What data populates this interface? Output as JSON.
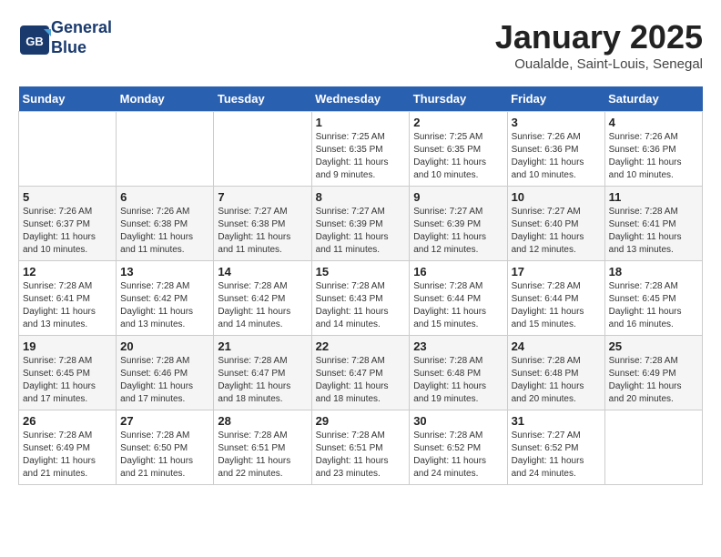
{
  "header": {
    "logo_line1": "General",
    "logo_line2": "Blue",
    "month": "January 2025",
    "location": "Oualalde, Saint-Louis, Senegal"
  },
  "days_of_week": [
    "Sunday",
    "Monday",
    "Tuesday",
    "Wednesday",
    "Thursday",
    "Friday",
    "Saturday"
  ],
  "weeks": [
    [
      {
        "day": "",
        "info": ""
      },
      {
        "day": "",
        "info": ""
      },
      {
        "day": "",
        "info": ""
      },
      {
        "day": "1",
        "info": "Sunrise: 7:25 AM\nSunset: 6:35 PM\nDaylight: 11 hours and 9 minutes."
      },
      {
        "day": "2",
        "info": "Sunrise: 7:25 AM\nSunset: 6:35 PM\nDaylight: 11 hours and 10 minutes."
      },
      {
        "day": "3",
        "info": "Sunrise: 7:26 AM\nSunset: 6:36 PM\nDaylight: 11 hours and 10 minutes."
      },
      {
        "day": "4",
        "info": "Sunrise: 7:26 AM\nSunset: 6:36 PM\nDaylight: 11 hours and 10 minutes."
      }
    ],
    [
      {
        "day": "5",
        "info": "Sunrise: 7:26 AM\nSunset: 6:37 PM\nDaylight: 11 hours and 10 minutes."
      },
      {
        "day": "6",
        "info": "Sunrise: 7:26 AM\nSunset: 6:38 PM\nDaylight: 11 hours and 11 minutes."
      },
      {
        "day": "7",
        "info": "Sunrise: 7:27 AM\nSunset: 6:38 PM\nDaylight: 11 hours and 11 minutes."
      },
      {
        "day": "8",
        "info": "Sunrise: 7:27 AM\nSunset: 6:39 PM\nDaylight: 11 hours and 11 minutes."
      },
      {
        "day": "9",
        "info": "Sunrise: 7:27 AM\nSunset: 6:39 PM\nDaylight: 11 hours and 12 minutes."
      },
      {
        "day": "10",
        "info": "Sunrise: 7:27 AM\nSunset: 6:40 PM\nDaylight: 11 hours and 12 minutes."
      },
      {
        "day": "11",
        "info": "Sunrise: 7:28 AM\nSunset: 6:41 PM\nDaylight: 11 hours and 13 minutes."
      }
    ],
    [
      {
        "day": "12",
        "info": "Sunrise: 7:28 AM\nSunset: 6:41 PM\nDaylight: 11 hours and 13 minutes."
      },
      {
        "day": "13",
        "info": "Sunrise: 7:28 AM\nSunset: 6:42 PM\nDaylight: 11 hours and 13 minutes."
      },
      {
        "day": "14",
        "info": "Sunrise: 7:28 AM\nSunset: 6:42 PM\nDaylight: 11 hours and 14 minutes."
      },
      {
        "day": "15",
        "info": "Sunrise: 7:28 AM\nSunset: 6:43 PM\nDaylight: 11 hours and 14 minutes."
      },
      {
        "day": "16",
        "info": "Sunrise: 7:28 AM\nSunset: 6:44 PM\nDaylight: 11 hours and 15 minutes."
      },
      {
        "day": "17",
        "info": "Sunrise: 7:28 AM\nSunset: 6:44 PM\nDaylight: 11 hours and 15 minutes."
      },
      {
        "day": "18",
        "info": "Sunrise: 7:28 AM\nSunset: 6:45 PM\nDaylight: 11 hours and 16 minutes."
      }
    ],
    [
      {
        "day": "19",
        "info": "Sunrise: 7:28 AM\nSunset: 6:45 PM\nDaylight: 11 hours and 17 minutes."
      },
      {
        "day": "20",
        "info": "Sunrise: 7:28 AM\nSunset: 6:46 PM\nDaylight: 11 hours and 17 minutes."
      },
      {
        "day": "21",
        "info": "Sunrise: 7:28 AM\nSunset: 6:47 PM\nDaylight: 11 hours and 18 minutes."
      },
      {
        "day": "22",
        "info": "Sunrise: 7:28 AM\nSunset: 6:47 PM\nDaylight: 11 hours and 18 minutes."
      },
      {
        "day": "23",
        "info": "Sunrise: 7:28 AM\nSunset: 6:48 PM\nDaylight: 11 hours and 19 minutes."
      },
      {
        "day": "24",
        "info": "Sunrise: 7:28 AM\nSunset: 6:48 PM\nDaylight: 11 hours and 20 minutes."
      },
      {
        "day": "25",
        "info": "Sunrise: 7:28 AM\nSunset: 6:49 PM\nDaylight: 11 hours and 20 minutes."
      }
    ],
    [
      {
        "day": "26",
        "info": "Sunrise: 7:28 AM\nSunset: 6:49 PM\nDaylight: 11 hours and 21 minutes."
      },
      {
        "day": "27",
        "info": "Sunrise: 7:28 AM\nSunset: 6:50 PM\nDaylight: 11 hours and 21 minutes."
      },
      {
        "day": "28",
        "info": "Sunrise: 7:28 AM\nSunset: 6:51 PM\nDaylight: 11 hours and 22 minutes."
      },
      {
        "day": "29",
        "info": "Sunrise: 7:28 AM\nSunset: 6:51 PM\nDaylight: 11 hours and 23 minutes."
      },
      {
        "day": "30",
        "info": "Sunrise: 7:28 AM\nSunset: 6:52 PM\nDaylight: 11 hours and 24 minutes."
      },
      {
        "day": "31",
        "info": "Sunrise: 7:27 AM\nSunset: 6:52 PM\nDaylight: 11 hours and 24 minutes."
      },
      {
        "day": "",
        "info": ""
      }
    ]
  ]
}
